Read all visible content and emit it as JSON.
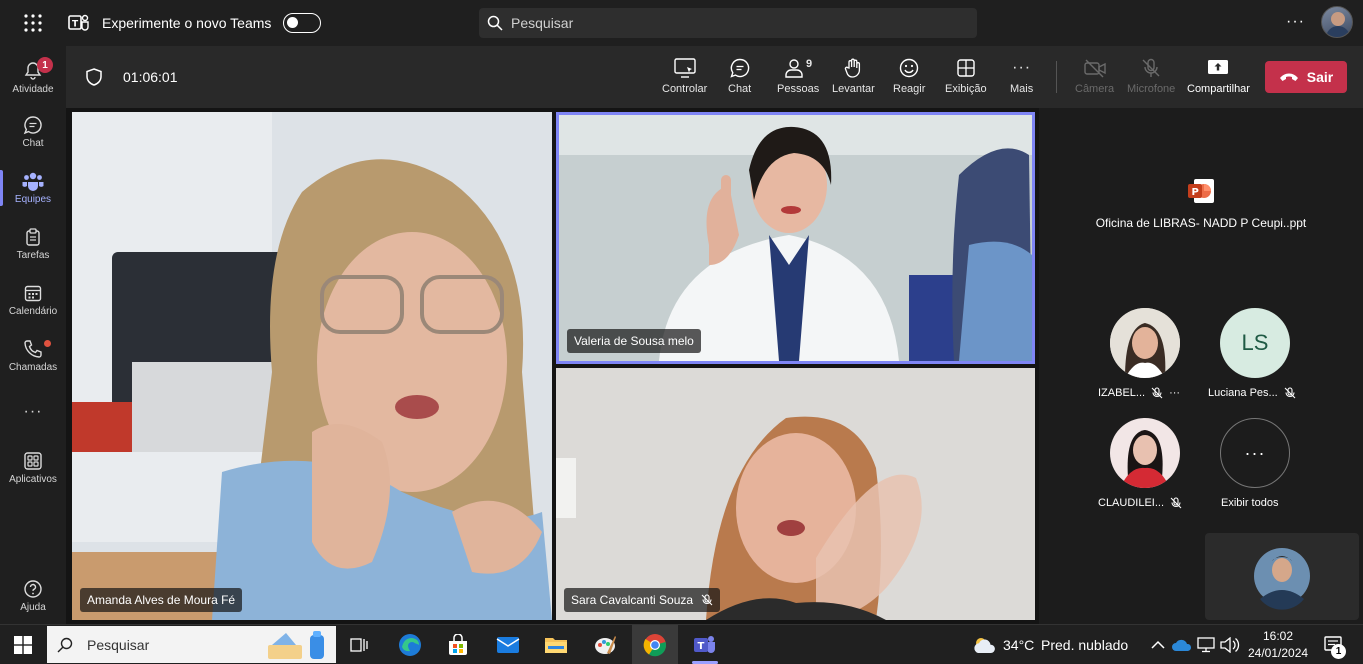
{
  "topbar": {
    "title": "Experimente o novo Teams",
    "search_placeholder": "Pesquisar"
  },
  "rail": {
    "items": [
      {
        "label": "Atividade",
        "badge": "1"
      },
      {
        "label": "Chat"
      },
      {
        "label": "Equipes"
      },
      {
        "label": "Tarefas"
      },
      {
        "label": "Calendário"
      },
      {
        "label": "Chamadas"
      },
      {
        "label": "Aplicativos"
      },
      {
        "label": "Ajuda"
      }
    ]
  },
  "meeting": {
    "timer": "01:06:01",
    "controls": [
      {
        "label": "Controlar"
      },
      {
        "label": "Chat"
      },
      {
        "label": "Pessoas",
        "count": "9"
      },
      {
        "label": "Levantar"
      },
      {
        "label": "Reagir"
      },
      {
        "label": "Exibição"
      },
      {
        "label": "Mais"
      },
      {
        "label": "Câmera"
      },
      {
        "label": "Microfone"
      },
      {
        "label": "Compartilhar"
      }
    ],
    "leave_label": "Sair"
  },
  "tiles": [
    {
      "name": "Amanda Alves de Moura Fé"
    },
    {
      "name": "Valeria de Sousa melo"
    },
    {
      "name": "Sara Cavalcanti Souza"
    }
  ],
  "side": {
    "shared_file": "Oficina de LIBRAS- NADD P Ceupi..ppt",
    "participants": [
      {
        "name": "IZABEL..."
      },
      {
        "name": "Luciana Pes...",
        "initials": "LS"
      },
      {
        "name": "CLAUDILEI..."
      },
      {
        "name": "Exibir todos"
      }
    ]
  },
  "taskbar": {
    "search_label": "Pesquisar",
    "weather_temp": "34°C",
    "weather_desc": "Pred. nublado",
    "time": "16:02",
    "date": "24/01/2024",
    "notif_count": "1"
  },
  "colors": {
    "accent": "#7f85f5",
    "leave": "#c4314b",
    "badge": "#c4314b"
  }
}
